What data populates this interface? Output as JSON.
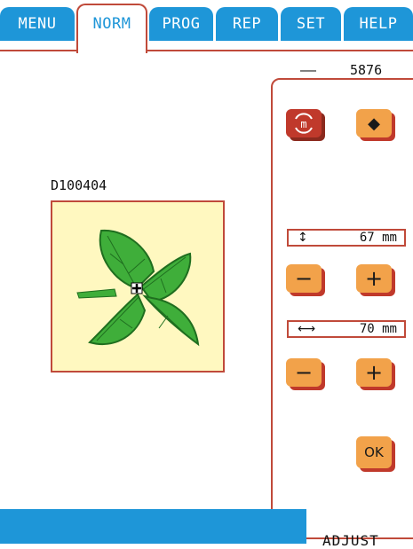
{
  "tabs": [
    {
      "label": "MENU",
      "active": false
    },
    {
      "label": "NORM",
      "active": true
    },
    {
      "label": "PROG",
      "active": false
    },
    {
      "label": "REP",
      "active": false
    },
    {
      "label": "SET",
      "active": false
    },
    {
      "label": "HELP",
      "active": false
    }
  ],
  "counter": {
    "dash": "——",
    "value": "5876"
  },
  "design": {
    "name": "D100404"
  },
  "height": {
    "symbol": "↕",
    "value": "67 mm"
  },
  "width": {
    "symbol": "⟷",
    "value": "70 mm"
  },
  "buttons": {
    "minus": "−",
    "plus": "+",
    "ok": "OK",
    "mirror_icon": "m",
    "rotate_icon": "◆"
  },
  "mode": {
    "label": "ADJUST"
  },
  "colors": {
    "tab_blue": "#1e96d8",
    "accent_red": "#c04a3a",
    "button_orange": "#f2a24a",
    "leaf_green": "#3fae3a",
    "preview_bg": "#fff8c0"
  }
}
